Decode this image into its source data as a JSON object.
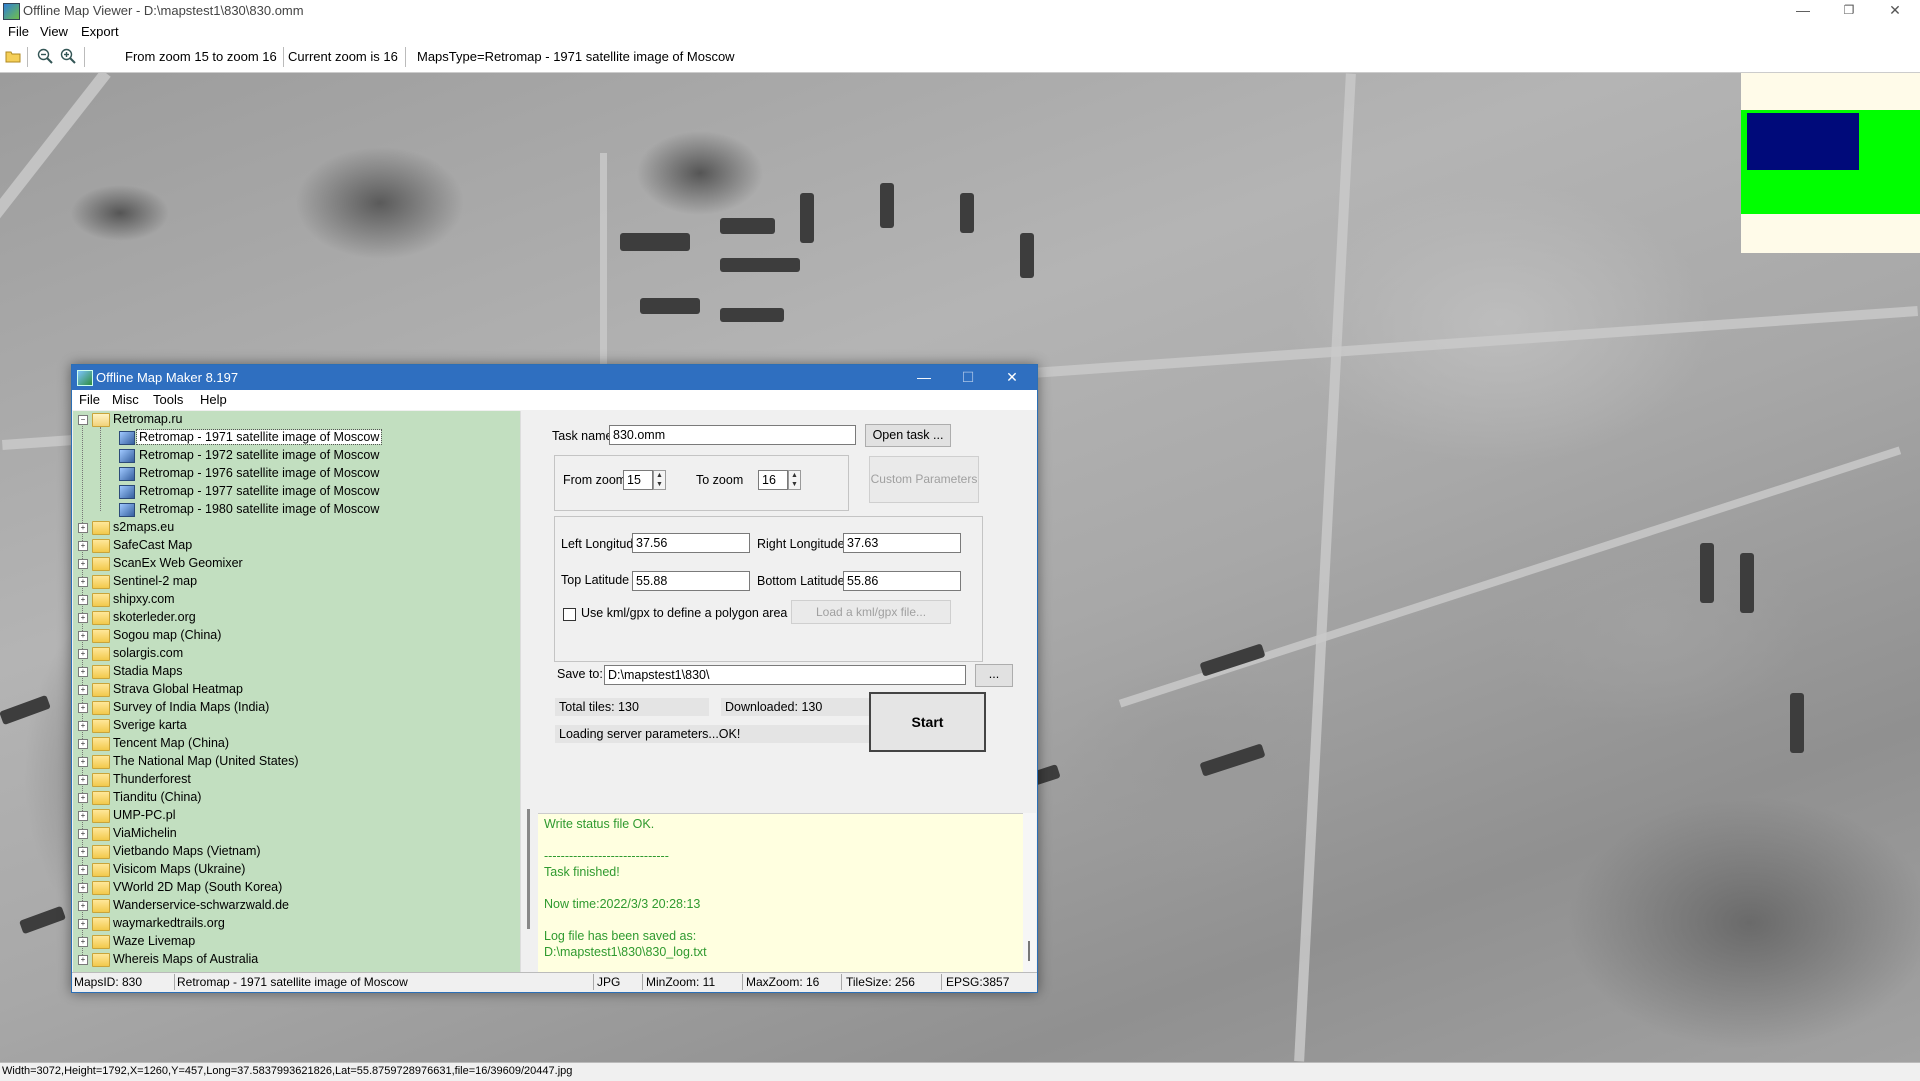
{
  "window": {
    "title": "Offline Map Viewer - D:\\mapstest1\\830\\830.omm",
    "controls": {
      "minimize": "—",
      "restore": "❐",
      "close": "✕"
    }
  },
  "menu": [
    "File",
    "View",
    "Export"
  ],
  "toolbar": {
    "icons": [
      "open-folder-icon",
      "zoom-out-icon",
      "zoom-in-icon"
    ],
    "zoom_range": "From zoom 15 to zoom 16",
    "current_zoom": "Current zoom is 16",
    "maps_type": "MapsType=Retromap - 1971 satellite image of Moscow"
  },
  "colors": {
    "minimap_bg": "#fffbe9",
    "minimap_green": "#00ff00",
    "minimap_view": "#000a7a",
    "tree_bg": "#c2dfc0",
    "log_bg": "#ffffe0",
    "log_text": "#2f9a2f",
    "dialog_title_bg": "#2f6fc0"
  },
  "status_bar": "Width=3072,Height=1792,X=1260,Y=457,Long=37.5837993621826,Lat=55.8759728976631,file=16/39609/20447.jpg",
  "dialog": {
    "title": "Offline Map Maker 8.197",
    "controls": {
      "minimize": "—",
      "maximize": "☐",
      "close": "✕"
    },
    "menu": [
      "File",
      "Misc",
      "Tools",
      "Help"
    ],
    "tree": {
      "root": "Retromap.ru",
      "children": [
        "Retromap - 1971 satellite image of Moscow",
        "Retromap - 1972 satellite image of Moscow",
        "Retromap - 1976 satellite image of Moscow",
        "Retromap - 1977 satellite image of Moscow",
        "Retromap - 1980 satellite image of Moscow"
      ],
      "folders": [
        "s2maps.eu",
        "SafeCast Map",
        "ScanEx Web Geomixer",
        "Sentinel-2 map",
        "shipxy.com",
        "skoterleder.org",
        "Sogou map (China)",
        "solargis.com",
        "Stadia Maps",
        "Strava Global Heatmap",
        "Survey of India Maps (India)",
        "Sverige karta",
        "Tencent Map (China)",
        "The National Map (United States)",
        "Thunderforest",
        "Tianditu (China)",
        "UMP-PC.pl",
        "ViaMichelin",
        "Vietbando Maps (Vietnam)",
        "Visicom Maps (Ukraine)",
        "VWorld 2D Map (South Korea)",
        "Wanderservice-schwarzwald.de",
        "waymarkedtrails.org",
        "Waze Livemap",
        "Whereis Maps of Australia"
      ]
    },
    "form": {
      "task_name_label": "Task name",
      "task_name_value": "830.omm",
      "open_task_button": "Open task ...",
      "from_zoom_label": "From zoom",
      "from_zoom_value": "15",
      "to_zoom_label": "To zoom",
      "to_zoom_value": "16",
      "custom_parameters_button": "Custom Parameters",
      "left_longitude_label": "Left Longitude",
      "left_longitude_value": "37.56",
      "right_longitude_label": "Right Longitude",
      "right_longitude_value": "37.63",
      "top_latitude_label": "Top Latitude",
      "top_latitude_value": "55.88",
      "bottom_latitude_label": "Bottom Latitude",
      "bottom_latitude_value": "55.86",
      "kml_checkbox_label": "Use kml/gpx to define a polygon area",
      "load_kml_button": "Load a kml/gpx file...",
      "save_to_label": "Save to:",
      "save_to_value": "D:\\mapstest1\\830\\",
      "browse_button": "...",
      "total_tiles": "Total tiles: 130",
      "downloaded": "Downloaded: 130",
      "loading_status": "Loading server parameters...OK!",
      "start_button": "Start"
    },
    "log": [
      "Write status file OK.",
      "",
      "------------------------------",
      "Task finished!",
      "",
      "Now time:2022/3/3 20:28:13",
      "",
      "Log file has been saved as:",
      "D:\\mapstest1\\830\\830_log.txt"
    ],
    "status": {
      "maps_id": "MapsID: 830",
      "map_name": "Retromap - 1971 satellite image of Moscow",
      "format": "JPG",
      "min_zoom": "MinZoom: 11",
      "max_zoom": "MaxZoom: 16",
      "tile_size": "TileSize: 256",
      "epsg": "EPSG:3857"
    }
  }
}
